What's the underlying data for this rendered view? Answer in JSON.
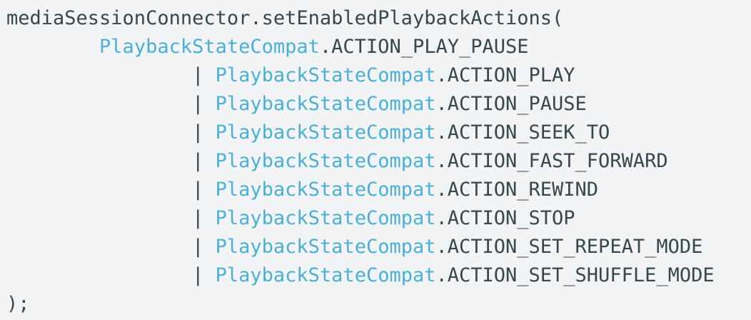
{
  "code": {
    "line_1": {
      "text": "mediaSessionConnector.setEnabledPlaybackActions("
    },
    "line_2": {
      "indent": "        ",
      "class_name": "PlaybackStateCompat",
      "rest": ".ACTION_PLAY_PAUSE"
    },
    "action_lines": [
      {
        "pipe": "|",
        "class_name": "PlaybackStateCompat",
        "rest": ".ACTION_PLAY"
      },
      {
        "pipe": "|",
        "class_name": "PlaybackStateCompat",
        "rest": ".ACTION_PAUSE"
      },
      {
        "pipe": "|",
        "class_name": "PlaybackStateCompat",
        "rest": ".ACTION_SEEK_TO"
      },
      {
        "pipe": "|",
        "class_name": "PlaybackStateCompat",
        "rest": ".ACTION_FAST_FORWARD"
      },
      {
        "pipe": "|",
        "class_name": "PlaybackStateCompat",
        "rest": ".ACTION_REWIND"
      },
      {
        "pipe": "|",
        "class_name": "PlaybackStateCompat",
        "rest": ".ACTION_STOP"
      },
      {
        "pipe": "|",
        "class_name": "PlaybackStateCompat",
        "rest": ".ACTION_SET_REPEAT_MODE"
      },
      {
        "pipe": "|",
        "class_name": "PlaybackStateCompat",
        "rest": ".ACTION_SET_SHUFFLE_MODE"
      }
    ],
    "closing_line": {
      "text": ");"
    },
    "colors": {
      "background": "#f1f3f4",
      "plain_text": "#37474f",
      "class_name": "#4bb0d6"
    }
  }
}
